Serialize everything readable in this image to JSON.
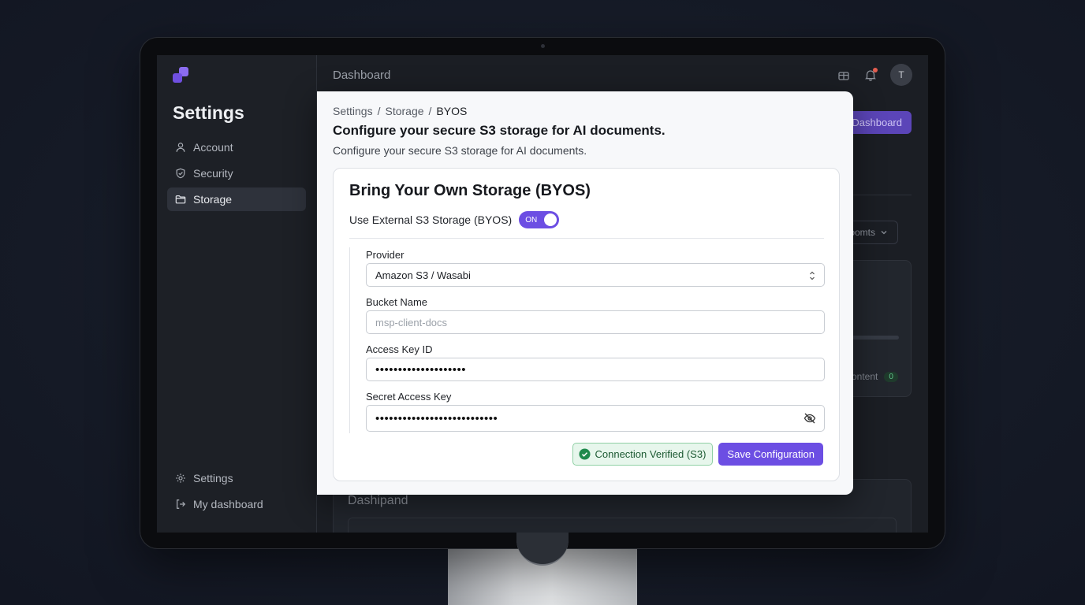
{
  "sidebar": {
    "title": "Settings",
    "items": [
      {
        "label": "Account",
        "icon": "user-icon"
      },
      {
        "label": "Security",
        "icon": "shield-icon"
      },
      {
        "label": "Storage",
        "icon": "folder-icon",
        "active": true
      }
    ],
    "bottom_items": [
      {
        "label": "Settings",
        "icon": "gear-icon"
      },
      {
        "label": "My dashboard",
        "icon": "logout-icon"
      }
    ]
  },
  "header": {
    "title": "Dashboard",
    "avatar_initial": "T"
  },
  "background": {
    "button_label": "Dashboard",
    "select_label": "oomts",
    "content_label": "ontent",
    "content_badge": "0",
    "panel_title": "Dashipand"
  },
  "modal": {
    "breadcrumb": [
      "Settings",
      "Storage",
      "BYOS"
    ],
    "title": "Configure your secure S3 storage for AI documents.",
    "subtitle": "Configure your secure S3 storage for AI documents.",
    "card": {
      "title": "Bring Your Own Storage (BYOS)",
      "toggle_label": "Use External S3 Storage (BYOS)",
      "toggle_state": "ON",
      "fields": {
        "provider": {
          "label": "Provider",
          "value": "Amazon S3 / Wasabi"
        },
        "bucket": {
          "label": "Bucket Name",
          "placeholder": "msp-client-docs"
        },
        "access_key": {
          "label": "Access Key ID",
          "value": "••••••••••••••••••••"
        },
        "secret_key": {
          "label": "Secret Access Key",
          "value": "•••••••••••••••••••••••••••"
        }
      },
      "status": "Connection Verified (S3)",
      "save_label": "Save Configuration"
    }
  },
  "colors": {
    "accent": "#6c4ee3",
    "success": "#1f8a4c",
    "sidebar_bg": "#1d2026"
  }
}
